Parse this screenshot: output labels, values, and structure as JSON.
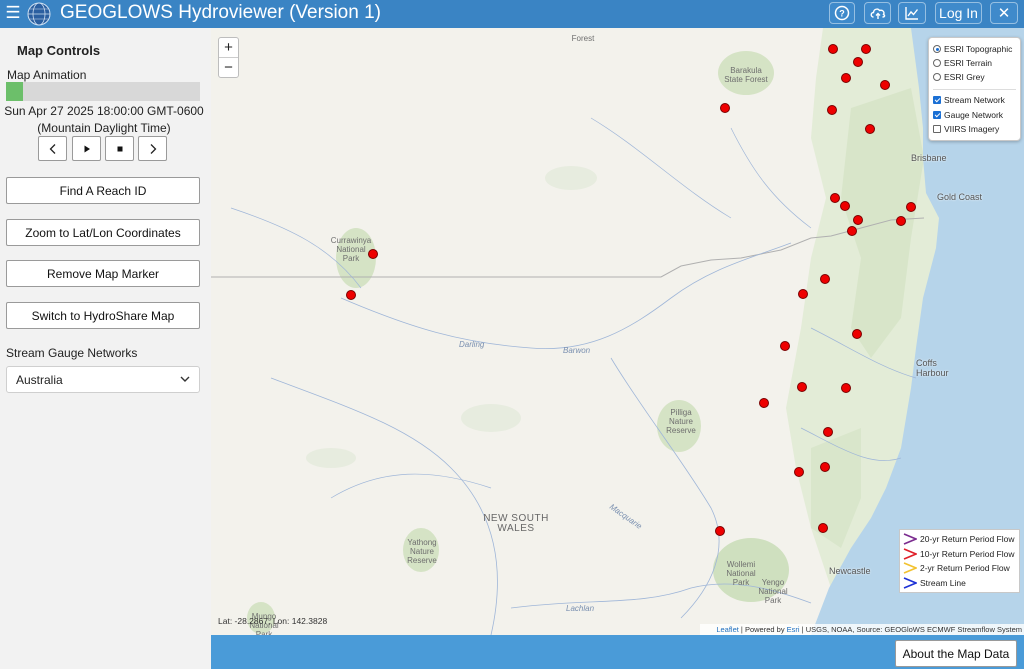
{
  "app": {
    "title": "GEOGLOWS Hydroviewer (Version 1)"
  },
  "header": {
    "login_label": "Log In",
    "close_label": "✕",
    "menu_icon": "hamburger-icon",
    "help_icon": "question-circle-icon",
    "upload_icon": "cloud-upload-icon",
    "chart_icon": "line-chart-icon"
  },
  "sidebar": {
    "title": "Map Controls",
    "animation_label": "Map Animation",
    "animation_progress": 0.09,
    "animation_date": "Sun Apr 27 2025 18:00:00 GMT-0600",
    "animation_timezone": "(Mountain Daylight Time)",
    "controls": {
      "prev": "‹",
      "play": "▶",
      "stop": "■",
      "next": "›"
    },
    "buttons": {
      "find_reach": "Find A Reach ID",
      "zoom_latlon": "Zoom to Lat/Lon Coordinates",
      "remove_marker": "Remove Map Marker",
      "switch_hydroshare": "Switch to HydroShare Map"
    },
    "gauge_networks_label": "Stream Gauge Networks",
    "gauge_network_selected": "Australia"
  },
  "map": {
    "zoom_in": "+",
    "zoom_out": "−",
    "labels": {
      "forest_top": "Forest",
      "barakula": "Barakula State Forest",
      "currawinya": "Currawinya National Park",
      "pilliga": "Pilliga Nature Reserve",
      "yathong": "Yathong Nature Reserve",
      "wollemi": "Wollemi National Park",
      "yengo": "Yengo National Park",
      "mungo": "Mungo National Park",
      "state": "NEW SOUTH WALES"
    },
    "cities": {
      "brisbane": "Brisbane",
      "gold_coast": "Gold Coast",
      "coffs_harbour": "Coffs Harbour",
      "newcastle": "Newcastle"
    },
    "rivers": {
      "darling": "Darling",
      "barwon": "Barwon",
      "macquarie": "Macquarie",
      "lachlan": "Lachlan"
    },
    "layers": {
      "basemaps": [
        {
          "label": "ESRI Topographic",
          "selected": true
        },
        {
          "label": "ESRI Terrain",
          "selected": false
        },
        {
          "label": "ESRI Grey",
          "selected": false
        }
      ],
      "overlays": [
        {
          "label": "Stream Network",
          "checked": true
        },
        {
          "label": "Gauge Network",
          "checked": true
        },
        {
          "label": "VIIRS Imagery",
          "checked": false
        }
      ]
    },
    "legend": [
      {
        "label": "20-yr Return Period Flow",
        "color": "#7b2c8f"
      },
      {
        "label": "10-yr Return Period Flow",
        "color": "#e0202a"
      },
      {
        "label": "2-yr Return Period Flow",
        "color": "#f2c230"
      },
      {
        "label": "Stream Line",
        "color": "#1e32d6"
      }
    ],
    "coordinates": "Lat: -28.2867, Lon: 142.3828",
    "attribution": {
      "leaflet": "Leaflet",
      "powered": " | Powered by ",
      "esri": "Esri",
      "rest": " | USGS, NOAA, Source: GEOGloWS ECMWF Streamflow System"
    },
    "gauge_marker_color": "#ee0000"
  },
  "footer": {
    "about_label": "About the Map Data"
  }
}
